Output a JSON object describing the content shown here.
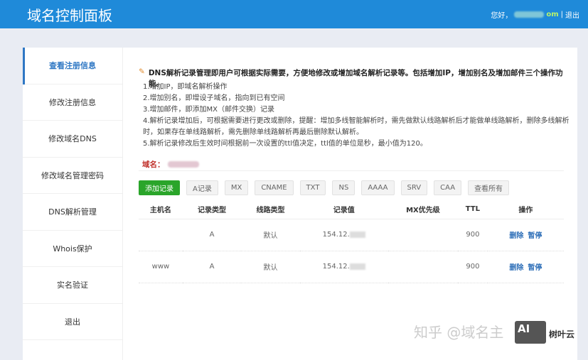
{
  "header": {
    "title": "域名控制面板",
    "greeting": "您好，",
    "username_suffix": "om",
    "separator": "|",
    "logout": "退出"
  },
  "sidebar": {
    "items": [
      {
        "label": "查看注册信息"
      },
      {
        "label": "修改注册信息"
      },
      {
        "label": "修改域名DNS"
      },
      {
        "label": "修改域名管理密码"
      },
      {
        "label": "DNS解析管理"
      },
      {
        "label": "Whois保护"
      },
      {
        "label": "实名验证"
      },
      {
        "label": "退出"
      }
    ]
  },
  "intro": "DNS解析记录管理即用户可根据实际需要，方便地修改或增加域名解析记录等。包括增加IP，增加别名及增加邮件三个操作功能。",
  "notes": [
    "1.增加IP，即域名解析操作",
    "2.增加别名，即增设子域名，指向到已有空间",
    "3.增加邮件，即添加MX（邮件交换）记录",
    "4.解析记录增加后，可根据需要进行更改或删除，提醒：增加多线智能解析时，需先做默认线路解析后才能做单线路解析，删除多线解析时，如果存在单线路解析，需先删除单线路解析再最后删除默认解析。",
    "5.解析记录修改后生效时间根据前一次设置的ttl值决定，ttl值的单位是秒，最小值为120。"
  ],
  "domain_label": "域名：",
  "buttons": {
    "add": "添加记录",
    "filters": [
      "A记录",
      "MX",
      "CNAME",
      "TXT",
      "NS",
      "AAAA",
      "SRV",
      "CAA",
      "查看所有"
    ]
  },
  "table": {
    "headers": [
      "主机名",
      "记录类型",
      "线路类型",
      "记录值",
      "MX优先级",
      "TTL",
      "操作"
    ],
    "rows": [
      {
        "host": "",
        "type": "A",
        "line": "默认",
        "value": "154.12.",
        "mx": "",
        "ttl": "900",
        "delete": "删除",
        "pause": "暂停"
      },
      {
        "host": "www",
        "type": "A",
        "line": "默认",
        "value": "154.12.",
        "mx": "",
        "ttl": "900",
        "delete": "删除",
        "pause": "暂停"
      }
    ]
  },
  "watermark": {
    "text": "知乎 @域名主",
    "badge": "AI",
    "brand": "树叶云"
  }
}
